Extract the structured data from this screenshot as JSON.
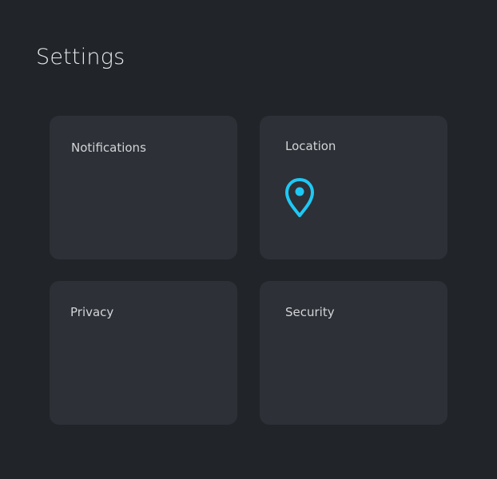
{
  "page": {
    "title": "Settings"
  },
  "cards": [
    {
      "label": "Notifications",
      "icon": null
    },
    {
      "label": "Location",
      "icon": "location-pin-icon",
      "icon_color": "#1ec8f5"
    },
    {
      "label": "Privacy",
      "icon": null
    },
    {
      "label": "Security",
      "icon": null
    }
  ],
  "colors": {
    "background": "#212429",
    "card": "#2d3036",
    "accent": "#1ec8f5",
    "text": "#d2d4d7"
  }
}
